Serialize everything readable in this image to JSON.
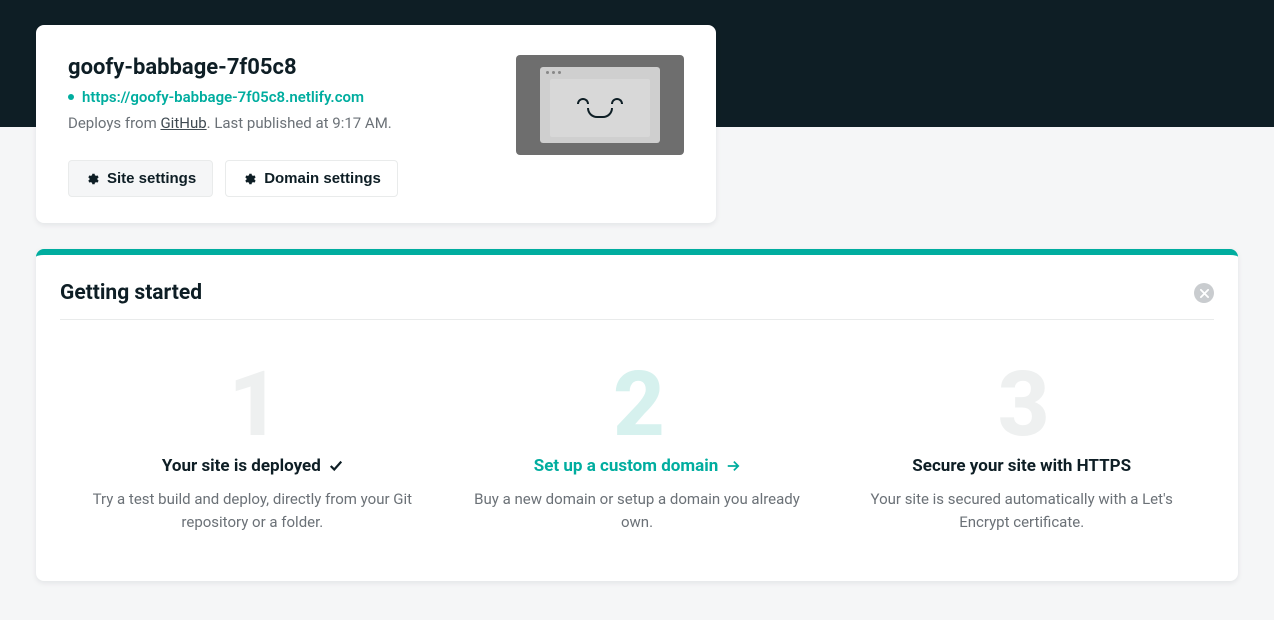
{
  "site": {
    "title": "goofy-babbage-7f05c8",
    "url": "https://goofy-babbage-7f05c8.netlify.com",
    "deploy_prefix": "Deploys from ",
    "deploy_source": "GitHub",
    "deploy_suffix": ". Last published at 9:17 AM."
  },
  "actions": {
    "site_settings": "Site settings",
    "domain_settings": "Domain settings"
  },
  "getting_started": {
    "title": "Getting started",
    "steps": [
      {
        "num": "1",
        "heading": "Your site is deployed",
        "desc": "Try a test build and deploy, directly from your Git repository or a folder."
      },
      {
        "num": "2",
        "heading": "Set up a custom domain",
        "desc": "Buy a new domain or setup a domain you already own."
      },
      {
        "num": "3",
        "heading": "Secure your site with HTTPS",
        "desc": "Your site is secured automatically with a Let's Encrypt certificate."
      }
    ]
  }
}
